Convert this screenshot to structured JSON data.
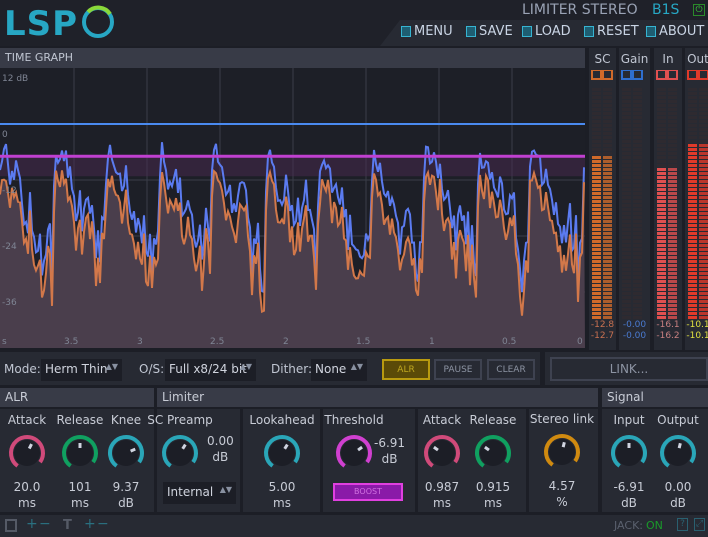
{
  "header": {
    "logo": "LSP",
    "plugin_name": "LIMITER STEREO",
    "variant": "B1S",
    "menu": [
      {
        "label": "MENU",
        "icon": "menu-icon"
      },
      {
        "label": "SAVE",
        "icon": "save-icon"
      },
      {
        "label": "LOAD",
        "icon": "load-icon"
      },
      {
        "label": "RESET",
        "icon": "reset-icon"
      },
      {
        "label": "ABOUT",
        "icon": "about-icon"
      }
    ]
  },
  "graph": {
    "title": "TIME GRAPH",
    "y_labels": [
      "12 dB",
      "0",
      "-12",
      "-24",
      "-36"
    ],
    "x_labels": [
      "s",
      "3.5",
      "3",
      "2.5",
      "2",
      "1.5",
      "1",
      "0.5",
      "0"
    ],
    "threshold_db": -6.91,
    "colors": {
      "input": "#5b7bf0",
      "output": "#d2784a",
      "threshold": "#c040d0",
      "ceiling": "#4a8af0"
    }
  },
  "meters": [
    {
      "label": "SC",
      "values": [
        "-12.8",
        "-12.7"
      ],
      "color": "#d06a2a",
      "val_color": "#c87050",
      "level": 0.73
    },
    {
      "label": "Gain",
      "values": [
        "-0.00",
        "-0.00"
      ],
      "color": "#2f6fd0",
      "val_color": "#4a7ad0",
      "level": 0
    },
    {
      "label": "In",
      "values": [
        "-16.1",
        "-16.2"
      ],
      "color": "#e05050",
      "val_color": "#c88080",
      "level": 0.67
    },
    {
      "label": "Out",
      "values": [
        "-10.1",
        "-10.1"
      ],
      "color": "#e03a2a",
      "val_color": "#e0e040",
      "level": 0.77
    }
  ],
  "controls": {
    "mode_label": "Mode:",
    "mode": "Herm Thin",
    "os_label": "O/S:",
    "os": "Full x8/24 bit",
    "dither_label": "Dither:",
    "dither": "None",
    "alr_btn": "ALR",
    "pause_btn": "PAUSE",
    "clear_btn": "CLEAR",
    "link_btn": "LINK..."
  },
  "sections": {
    "alr": "ALR",
    "limiter": "Limiter",
    "signal": "Signal"
  },
  "knobs": {
    "alr_attack": {
      "label": "Attack",
      "value": "20.0",
      "unit": "ms",
      "color": "#d04a7a"
    },
    "alr_release": {
      "label": "Release",
      "value": "101",
      "unit": "ms",
      "color": "#10a060"
    },
    "alr_knee": {
      "label": "Knee",
      "value": "9.37",
      "unit": "dB",
      "color": "#2aa6b8"
    },
    "sc_preamp": {
      "label": "SC Preamp",
      "value": "0.00",
      "unit": "dB",
      "color": "#2aa6b8"
    },
    "lookahead": {
      "label": "Lookahead",
      "value": "5.00",
      "unit": "ms",
      "color": "#2aa6b8"
    },
    "threshold": {
      "label": "Threshold",
      "value": "-6.91",
      "unit": "dB",
      "color": "#d040d0"
    },
    "attack": {
      "label": "Attack",
      "value": "0.987",
      "unit": "ms",
      "color": "#d04a7a"
    },
    "release": {
      "label": "Release",
      "value": "0.915",
      "unit": "ms",
      "color": "#10a060"
    },
    "stereo_link": {
      "label": "Stereo link",
      "value": "4.57",
      "unit": "%",
      "color": "#d08a10"
    },
    "input": {
      "label": "Input",
      "value": "-6.91",
      "unit": "dB",
      "color": "#2aa6b8"
    },
    "output": {
      "label": "Output",
      "value": "0.00",
      "unit": "dB",
      "color": "#2aa6b8"
    }
  },
  "sc_source": "Internal",
  "boost_btn": "BOOST",
  "footer": {
    "jack_label": "JACK:",
    "jack_status": "ON"
  }
}
